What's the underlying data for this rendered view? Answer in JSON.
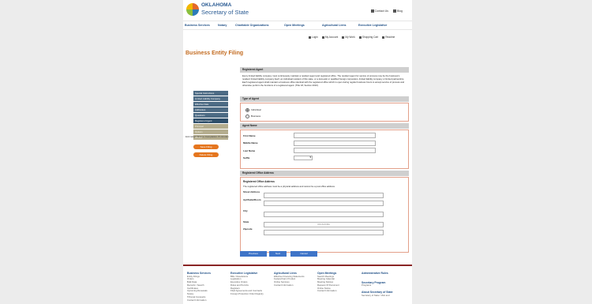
{
  "header": {
    "logo_line1": "OKLAHOMA",
    "logo_line2": "Secretary of State",
    "contact": "Contact Us",
    "blog": "Blog"
  },
  "nav": [
    "Business Services",
    "Notary",
    "Charitable Organizations",
    "Open Meetings",
    "Agricultural Liens",
    "Executive Legislative"
  ],
  "utility": [
    "Login",
    "My Account",
    "My Work",
    "Shopping Cart",
    "Readme"
  ],
  "page_title": "Business Entity Filing",
  "side_nav": [
    "Special Instructions",
    "Limited Liability Company",
    "Effective Date",
    "Addresses",
    "Questions",
    "Registered Agent",
    "Principal",
    "Options",
    "Review"
  ],
  "save_note": "Estimated Time to Completion: 8 minutes",
  "save_btn": "Save Filing",
  "delete_btn": "Delete Filing",
  "sections": {
    "ra_title": "Registered Agent",
    "ra_intro": "Every limited liability company must continuously maintain a resident agent and registered office. The resident agent for service of process may be the business's resident limited liability company itself, an individual resident of this state, or a domestic or qualified foreign corporation, limited liability company or limited partnership. Each registered agent shall maintain a business office identical with the registered office which is open during regular business hours to accept service of process and otherwise perform the functions of a registered agent. (Title 18, Section 2010).",
    "type_title": "Type of Agent",
    "type_opt1": "Individual",
    "type_opt2": "Business",
    "name_title": "Agent Name",
    "first": "First Name",
    "middle": "Middle Name",
    "last": "Last Name",
    "suffix": "Suffix",
    "office_title": "Registered Office Address",
    "office_label": "Registered Office Address",
    "office_note": "The registered office address must be a physical address and cannot be a post office address.",
    "street": "Street Address",
    "apt": "Apt/Suite/Room",
    "city": "City",
    "state": "State",
    "state_val": "OKLAHOMA",
    "zip": "Zipcode"
  },
  "buttons": [
    "Previous",
    "Next",
    "Cancel"
  ],
  "footer": {
    "col1": {
      "h": "Business Services",
      "items": [
        "Entity Filings",
        "Orders",
        "Bulk Data",
        "Records / Search",
        "Certificates",
        "Upcoming Renewals",
        "Notary",
        "Tribunal Compacts",
        "Contact Information"
      ]
    },
    "col2": {
      "h": "Executive Legislative",
      "items": [
        "Bills / Resolutions",
        "Legislation",
        "Executive Orders",
        "Rules and Permits",
        "Registers",
        "Filed Agreements and Contracts",
        "Foreign Protection Order Registry"
      ]
    },
    "col3": {
      "h": "Agricultural Liens",
      "items": [
        "Effective Financing Statements",
        "Federal Farm Product",
        "Online Services",
        "Contact Information"
      ]
    },
    "col4": {
      "h": "Open Meetings",
      "items": [
        "Search Meetings",
        "Meeting Calendar",
        "Meeting Notices",
        "Request Of Document",
        "Online Notice",
        "Contact Information"
      ]
    },
    "col5": {
      "h": "Administrative Rules",
      "h2": "Secretary Program",
      "sub2": "Programs",
      "h3": "About Secretary of State",
      "sub3": "Secretary of State / Visit and"
    }
  }
}
